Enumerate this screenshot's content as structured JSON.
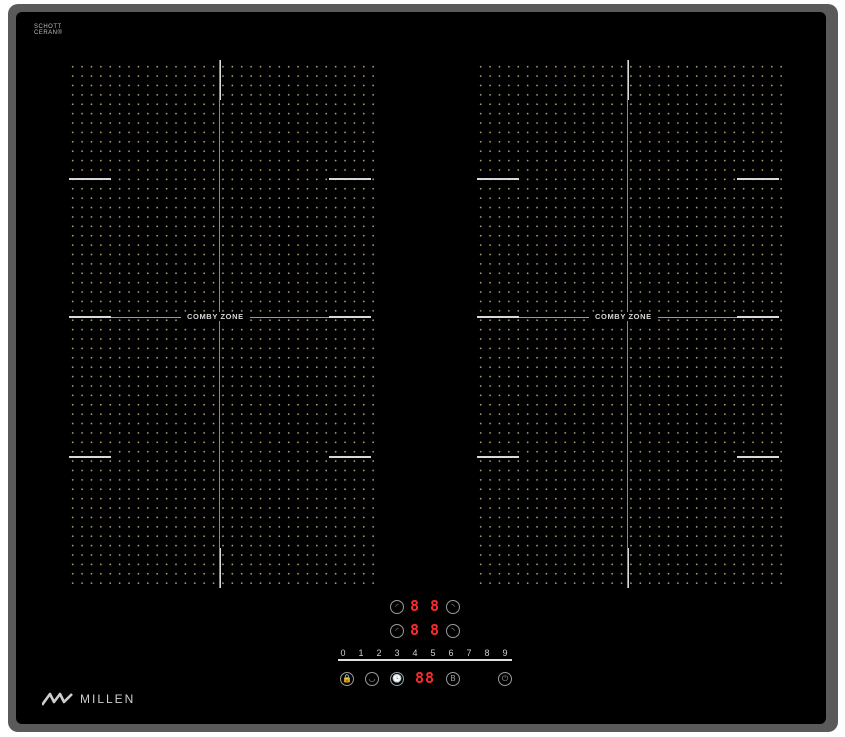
{
  "brand_glass": {
    "line1": "SCHOTT",
    "line2": "CERAN®"
  },
  "zones": {
    "left_label": "COMBY ZONE",
    "right_label": "COMBY ZONE"
  },
  "controls": {
    "row1_display": "8 8",
    "row2_display": "8 8",
    "timer_display": "88",
    "scale": [
      "0",
      "1",
      "2",
      "3",
      "4",
      "5",
      "6",
      "7",
      "8",
      "9"
    ],
    "icons": {
      "lock": "🔒",
      "pot": "◡",
      "timer": "🕓",
      "boost": "B",
      "power": "⏻",
      "left": "◜",
      "right": "◝"
    }
  },
  "brand": {
    "name": "MILLEN"
  },
  "colors": {
    "glass": "#000000",
    "frame": "#5a5a5a",
    "display": "#ff2a2a",
    "dots": "#c8b88a"
  }
}
